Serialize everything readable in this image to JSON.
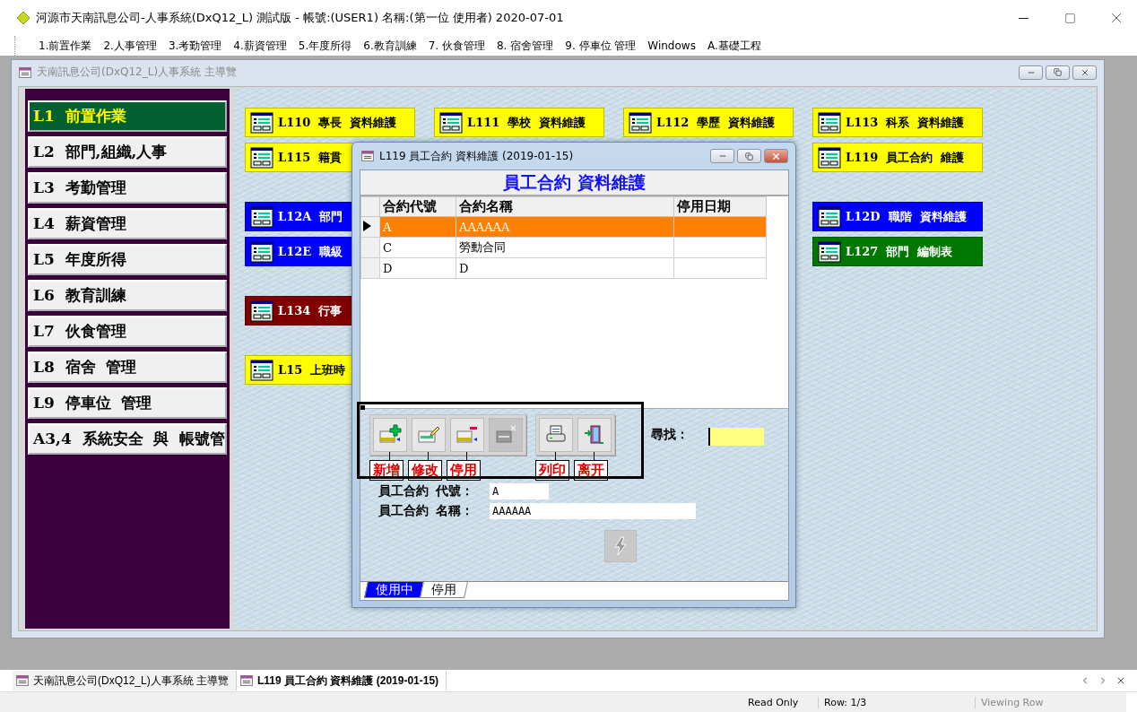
{
  "app": {
    "title": "河源市天南訊息公司-人事系統(DxQ12_L) 測試版 - 帳號:(USER1)  名稱:(第一位 使用者) 2020-07-01"
  },
  "menu": [
    "1.前置作業",
    "2.人事管理",
    "3.考勤管理",
    "4.薪資管理",
    "5.年度所得",
    "6.教育訓練",
    "7. 伙食管理",
    "8. 宿舍管理",
    "9. 停車位 管理",
    "Windows",
    "A.基礎工程"
  ],
  "main_window": {
    "title": "天南訊息公司(DxQ12_L)人事系統 主導覽",
    "nav": [
      {
        "label": "L1  前置作業",
        "selected": true
      },
      {
        "label": "L2  部門,組織,人事",
        "selected": false
      },
      {
        "label": "L3  考勤管理",
        "selected": false
      },
      {
        "label": "L4  薪資管理",
        "selected": false
      },
      {
        "label": "L5  年度所得",
        "selected": false
      },
      {
        "label": "L6  教育訓練",
        "selected": false
      },
      {
        "label": "L7  伙食管理",
        "selected": false
      },
      {
        "label": "L8  宿舍  管理",
        "selected": false
      },
      {
        "label": "L9  停車位  管理",
        "selected": false
      },
      {
        "label": "A3,4  系統安全  與  帳號管",
        "selected": false
      }
    ],
    "tile_sections": [
      [
        {
          "left": [
            {
              "label": "L110  專長  資料維護",
              "color": "#ffff00"
            },
            {
              "label": "L111  學校  資料維護",
              "color": "#ffff00"
            },
            {
              "label": "L112  學歷  資料維護",
              "color": "#ffff00"
            },
            {
              "label": "L113  科系  資料維護",
              "color": "#ffff00"
            }
          ]
        },
        {
          "left": [
            {
              "label": "L115  籍貫",
              "color": "#ffff00"
            }
          ],
          "right": [
            {
              "label": "L119  員工合約  維護",
              "color": "#ffff00"
            }
          ]
        }
      ],
      [
        {
          "left": [
            {
              "label": "L12A  部門",
              "color": "#0000ff"
            }
          ],
          "right": [
            {
              "label": "L12D  職階  資料維護",
              "color": "#0000ff"
            }
          ]
        },
        {
          "left": [
            {
              "label": "L12E  職級",
              "color": "#0000ff"
            }
          ],
          "right": [
            {
              "label": "L127  部門  編制表",
              "color": "#007800"
            }
          ]
        }
      ],
      [
        {
          "left": [
            {
              "label": "L134  行事",
              "color": "#800000"
            }
          ]
        }
      ],
      [
        {
          "left": [
            {
              "label": "L15  上班時",
              "color": "#ffff00"
            }
          ]
        }
      ]
    ]
  },
  "dialog": {
    "title": "L119 員工合約 資料維護 (2019-01-15)",
    "heading": "員工合約 資料維護",
    "columns": [
      "合約代號",
      "合約名稱",
      "停用日期"
    ],
    "rows": [
      {
        "code": "A",
        "name": "AAAAAA",
        "selected": true
      },
      {
        "code": "C",
        "name": "勞動合同",
        "selected": false
      },
      {
        "code": "D",
        "name": "D",
        "selected": false
      }
    ],
    "toolbar": [
      [
        {
          "kind": "add",
          "callout": "新增",
          "disabled": false
        },
        {
          "kind": "edit",
          "callout": "修改",
          "disabled": false
        },
        {
          "kind": "disable",
          "callout": "停用",
          "disabled": false
        },
        {
          "kind": "delete",
          "disabled": true
        }
      ],
      [
        {
          "kind": "print",
          "callout": "列印",
          "disabled": false
        },
        {
          "kind": "exit",
          "callout": "离开",
          "disabled": false
        }
      ]
    ],
    "search_label": "尋找：",
    "form": [
      {
        "label": "員工合約  代號：",
        "value": "A"
      },
      {
        "label": "員工合約  名稱：",
        "value": "AAAAAA"
      }
    ],
    "run_button": {
      "disabled": true
    },
    "tabs": [
      {
        "label": "使用中",
        "selected": true
      },
      {
        "label": "停用",
        "selected": false
      }
    ]
  },
  "taskbar": [
    {
      "label": "天南訊息公司(DxQ12_L)人事系統 主導覽",
      "selected": false
    },
    {
      "label": "L119 員工合約 資料維護 (2019-01-15)",
      "selected": true
    }
  ],
  "status_bar": {
    "mode": "Read Only",
    "row": "Row: 1/3",
    "state": "Viewing Row"
  }
}
